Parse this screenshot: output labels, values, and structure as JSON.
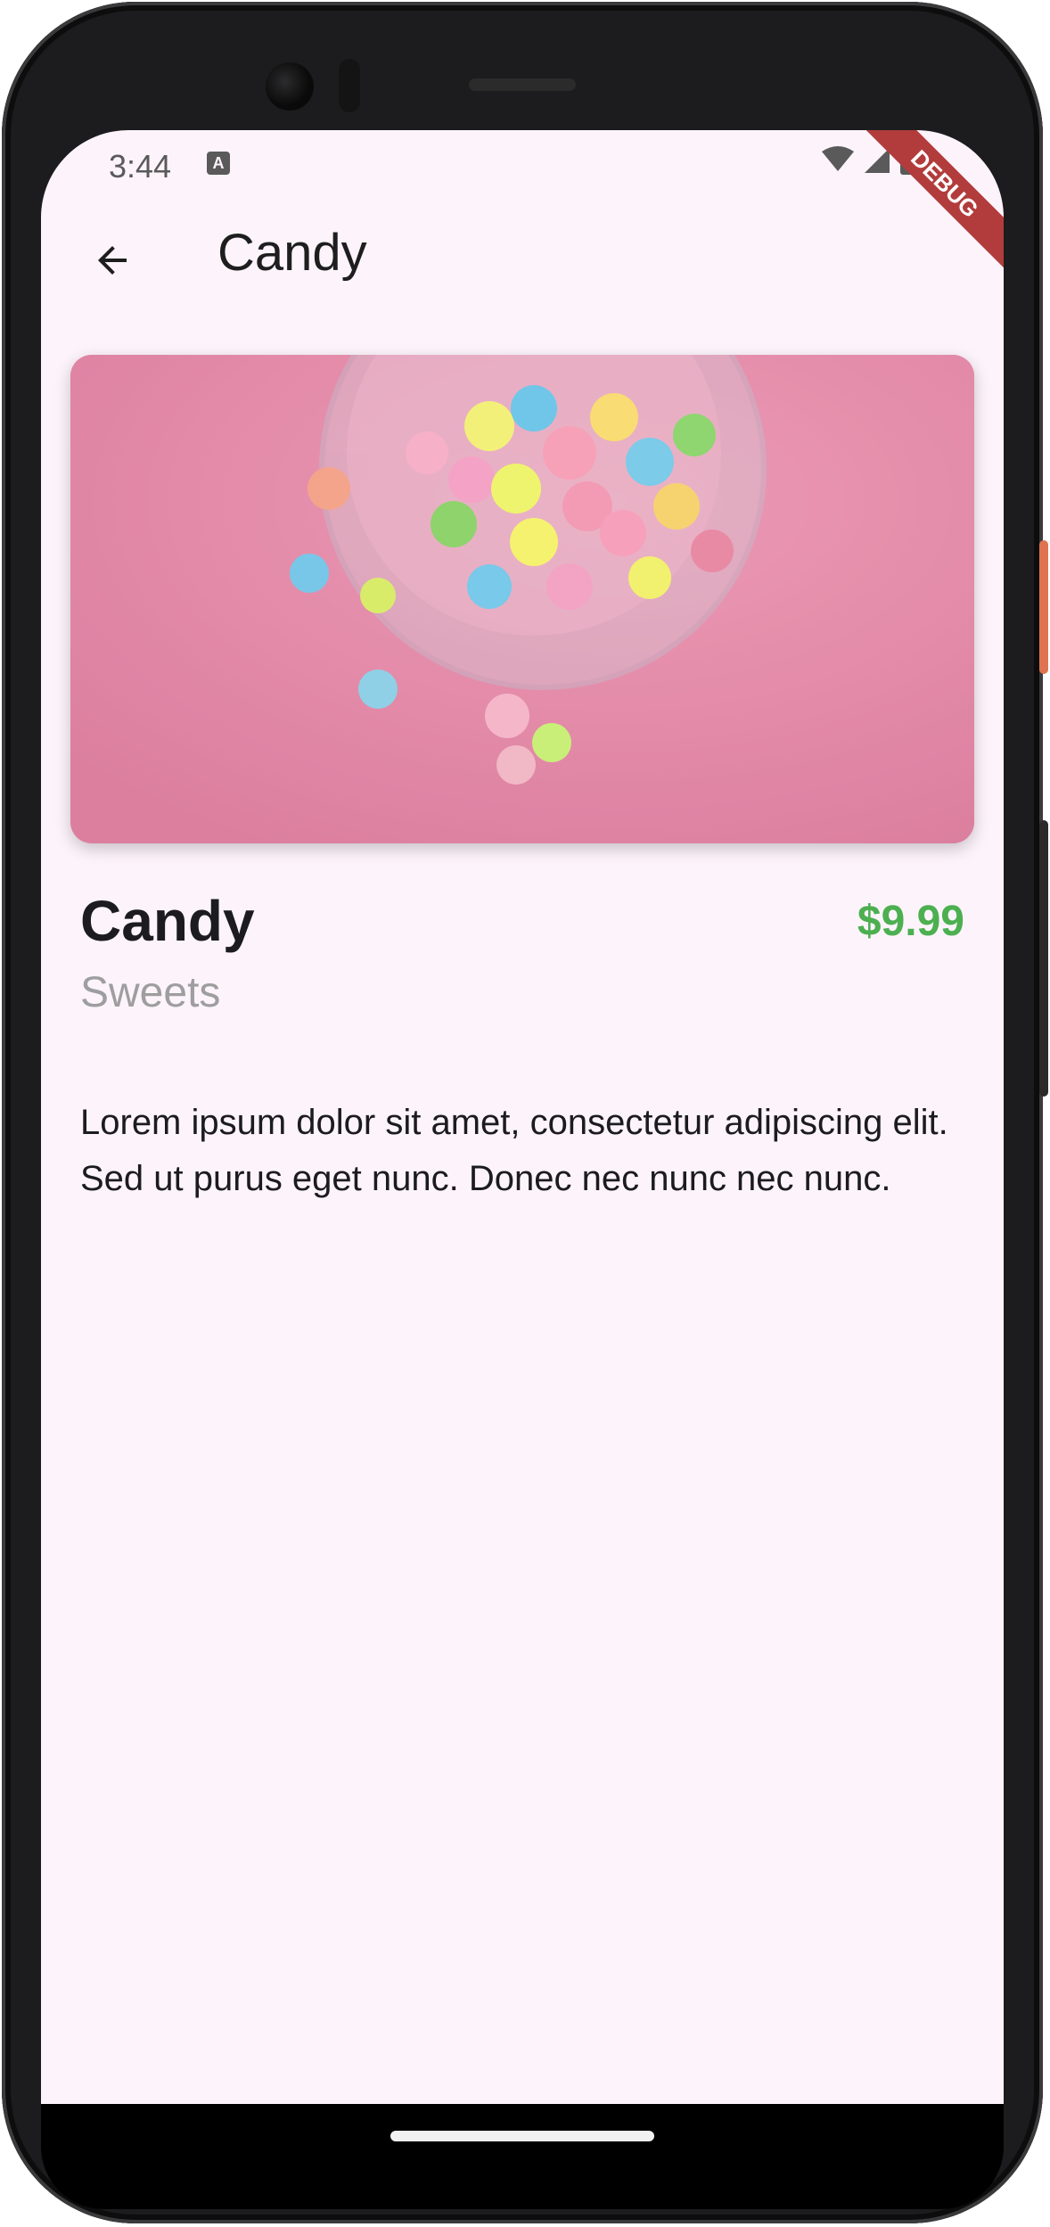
{
  "status_bar": {
    "time": "3:44",
    "notification_icon": "A",
    "icons": [
      "wifi-icon",
      "cellular-icon",
      "battery-icon"
    ]
  },
  "debug_banner": "DEBUG",
  "app_bar": {
    "back_icon": "arrow-back-icon",
    "title": "Candy"
  },
  "product": {
    "image_alt": "Bowl of colorful marshmallow candy on pink background",
    "name": "Candy",
    "price": "$9.99",
    "category": "Sweets",
    "description": "Lorem ipsum dolor sit amet, consectetur adipiscing elit. Sed ut purus eget nunc. Donec nec nunc nec nunc."
  },
  "colors": {
    "background": "#fdf4fb",
    "price": "#4caf50",
    "category": "#9e9e9e",
    "debug_banner": "#b23c3c",
    "image_background": "#e58aa8"
  }
}
